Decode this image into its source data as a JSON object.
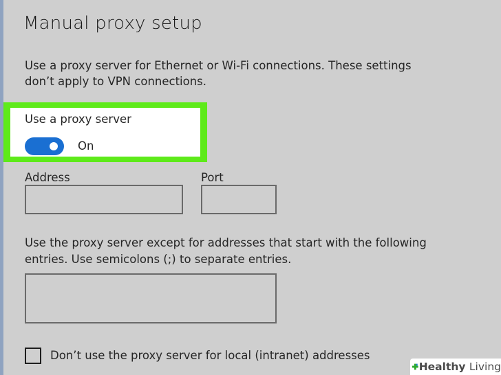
{
  "header": {
    "title": "Manual proxy setup"
  },
  "description": {
    "line1": "Use a proxy server for Ethernet or Wi-Fi connections. These settings",
    "line2": "don’t apply to VPN connections."
  },
  "proxy": {
    "label": "Use a proxy server",
    "toggle_state": "On",
    "toggle_on": true
  },
  "fields": {
    "address_label": "Address",
    "address_value": "",
    "port_label": "Port",
    "port_value": ""
  },
  "exceptions": {
    "line1": "Use the proxy server except for addresses that start with the following",
    "line2": "entries. Use semicolons (;) to separate entries.",
    "value": ""
  },
  "local": {
    "label": "Don’t use the proxy server for local (intranet) addresses",
    "checked": false
  },
  "watermark": {
    "brand_bold": "Healthy",
    "brand_light": "Living"
  },
  "colors": {
    "background": "#cfcfcf",
    "highlight": "#5eea1a",
    "toggle_accent": "#1a6fd2",
    "watermark_green": "#2eaa2e"
  },
  "icons": {
    "watermark": "plus-cross-icon"
  }
}
